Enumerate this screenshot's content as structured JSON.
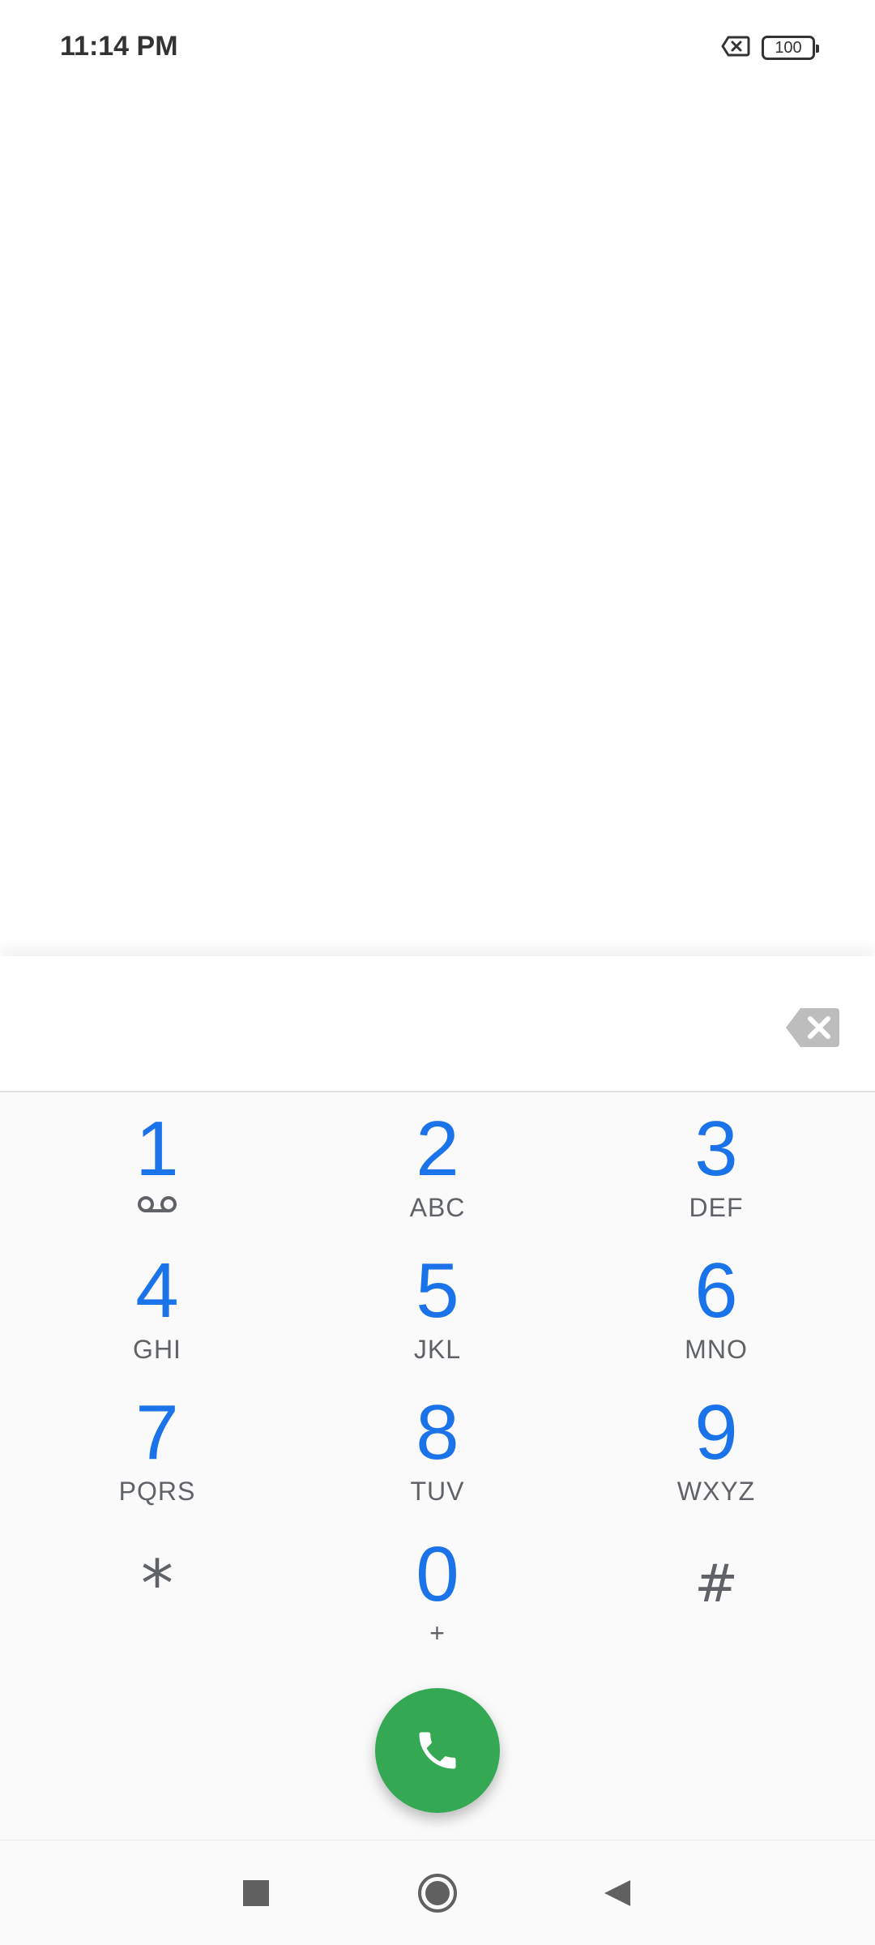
{
  "status_bar": {
    "time": "11:14 PM",
    "battery_level": "100",
    "icons": [
      "no-sim-icon",
      "battery-icon"
    ]
  },
  "dialer": {
    "digits_value": "",
    "backspace_icon": "backspace-icon",
    "keys": [
      {
        "digit": "1",
        "letters": "",
        "sub_icon": "voicemail-icon"
      },
      {
        "digit": "2",
        "letters": "ABC"
      },
      {
        "digit": "3",
        "letters": "DEF"
      },
      {
        "digit": "4",
        "letters": "GHI"
      },
      {
        "digit": "5",
        "letters": "JKL"
      },
      {
        "digit": "6",
        "letters": "MNO"
      },
      {
        "digit": "7",
        "letters": "PQRS"
      },
      {
        "digit": "8",
        "letters": "TUV"
      },
      {
        "digit": "9",
        "letters": "WXYZ"
      },
      {
        "digit": "*",
        "letters": ""
      },
      {
        "digit": "0",
        "letters": "+"
      },
      {
        "digit": "#",
        "letters": ""
      }
    ],
    "call_icon": "phone-icon"
  },
  "colors": {
    "digit_blue": "#1a73e8",
    "call_green": "#34a853",
    "letters_gray": "#5f6368"
  },
  "nav_bar": {
    "icons": [
      "recents-square-icon",
      "home-circle-icon",
      "back-triangle-icon"
    ]
  }
}
